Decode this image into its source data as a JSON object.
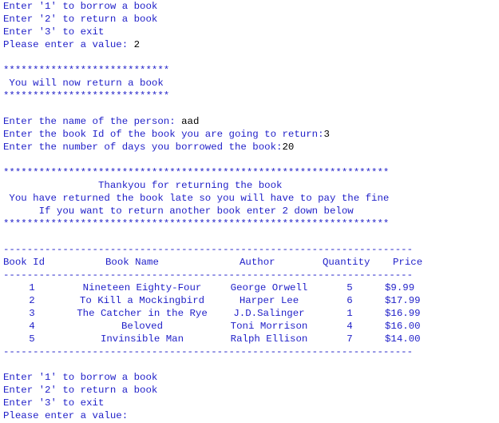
{
  "colors": {
    "text": "#1f1fc8",
    "input": "#000000",
    "background": "#ffffff"
  },
  "menu_top": [
    "Enter '1' to borrow a book",
    "Enter '2' to return a book",
    "Enter '3' to exit"
  ],
  "prompt_top": {
    "label": "Please enter a value: ",
    "value": "2"
  },
  "banner1": {
    "stars": "****************************",
    "text": " You will now return a book"
  },
  "return_form": {
    "name_label": "Enter the name of the person: ",
    "name_value": "aad",
    "id_label": "Enter the book Id of the book you are going to return:",
    "id_value": "3",
    "days_label": "Enter the number of days you borrowed the book:",
    "days_value": "20"
  },
  "banner2": {
    "stars": "*****************************************************************",
    "line1": "                Thankyou for returning the book",
    "line2": " You have returned the book late so you will have to pay the fine",
    "line3": "      If you want to return another book enter 2 down below"
  },
  "table": {
    "rule": "---------------------------------------------------------------------",
    "headers": [
      "Book Id",
      "Book Name",
      "Author",
      "Quantity",
      "Price"
    ],
    "rows": [
      [
        "1",
        "Nineteen Eighty-Four",
        "George Orwell",
        "5",
        "$9.99"
      ],
      [
        "2",
        "To Kill a Mockingbird",
        "Harper Lee",
        "6",
        "$17.99"
      ],
      [
        "3",
        "The Catcher in the Rye",
        "J.D.Salinger",
        "1",
        "$16.99"
      ],
      [
        "4",
        "Beloved",
        "Toni Morrison",
        "4",
        "$16.00"
      ],
      [
        "5",
        "Invinsible Man",
        "Ralph Ellison",
        "7",
        "$14.00"
      ]
    ]
  },
  "menu_bottom": [
    "Enter '1' to borrow a book",
    "Enter '2' to return a book",
    "Enter '3' to exit"
  ],
  "prompt_bottom": {
    "label": "Please enter a value:"
  }
}
